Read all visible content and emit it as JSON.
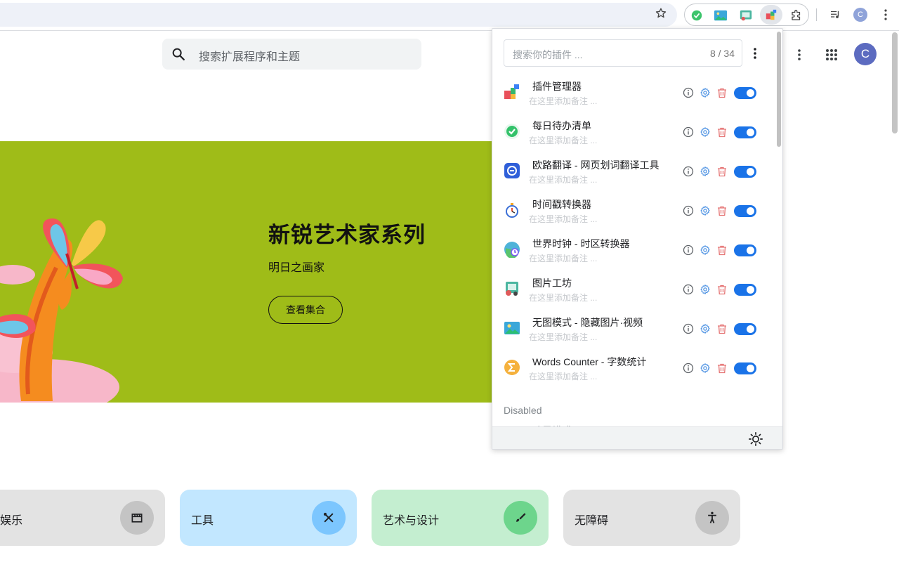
{
  "toolbar": {
    "avatar_letter": "C"
  },
  "page": {
    "search_placeholder": "搜索扩展程序和主题",
    "avatar_letter": "C",
    "hero": {
      "title": "新锐艺术家系列",
      "subtitle": "明日之画家",
      "button": "查看集合"
    },
    "categories": [
      {
        "label": "娱乐",
        "bg": "#e3e3e3",
        "circle": "#c4c4c4"
      },
      {
        "label": "工具",
        "bg": "#c2e7ff",
        "circle": "#7cc6fe"
      },
      {
        "label": "艺术与设计",
        "bg": "#c4eed0",
        "circle": "#6dd58c"
      },
      {
        "label": "无障碍",
        "bg": "#e3e3e3",
        "circle": "#c4c4c4"
      }
    ]
  },
  "popup": {
    "search_placeholder": "搜索你的插件 ...",
    "count": "8 / 34",
    "note_placeholder": "在这里添加备注 ...",
    "items": [
      {
        "name": "插件管理器",
        "icon": "blocks-icon"
      },
      {
        "name": "每日待办清单",
        "icon": "check-circle-icon"
      },
      {
        "name": "欧路翻译 - 网页划词翻译工具",
        "icon": "translate-icon"
      },
      {
        "name": "时间戳转换器",
        "icon": "stopwatch-icon"
      },
      {
        "name": "世界时钟 - 时区转换器",
        "icon": "globe-clock-icon"
      },
      {
        "name": "图片工坊",
        "icon": "image-workshop-icon"
      },
      {
        "name": "无图模式 - 隐藏图片·视频",
        "icon": "picture-icon"
      },
      {
        "name": "Words Counter - 字数统计",
        "icon": "sigma-icon"
      }
    ],
    "disabled_label": "Disabled",
    "disabled_first": "暗黑模式 Ch",
    "accent": "#1a73e8",
    "delete_color": "#e57373",
    "gear_color": "#4a90e2"
  }
}
